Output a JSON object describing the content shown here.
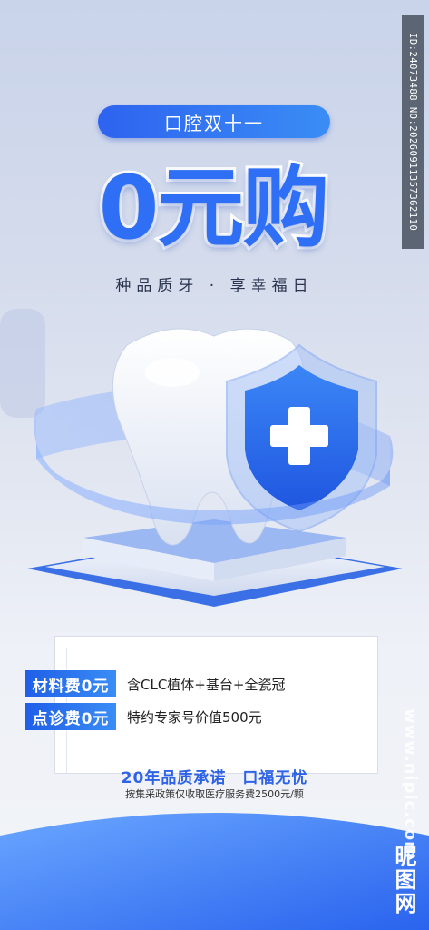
{
  "header": {
    "pill_text": "口腔双十一",
    "headline": "0元购",
    "subtitle": "种品质牙 · 享幸福日"
  },
  "offers": [
    {
      "tag": "材料费0元",
      "desc": "含CLC植体+基台+全瓷冠"
    },
    {
      "tag": "点诊费0元",
      "desc": "特约专家号价值500元"
    }
  ],
  "footer": {
    "promise": "20年品质承诺　口福无忧",
    "note": "按集采政策仅收取医疗服务费2500元/颗"
  },
  "watermark": {
    "id_text": "ID:24073488 NO:20260911357362110",
    "site": "www.nipic.com",
    "logo": "昵图网"
  },
  "colors": {
    "accent": "#2f6ff5",
    "accent_light": "#3a8df5",
    "background_top": "#c9d3ea"
  },
  "icons": {
    "tooth": "tooth-icon",
    "shield": "shield-cross-icon"
  }
}
